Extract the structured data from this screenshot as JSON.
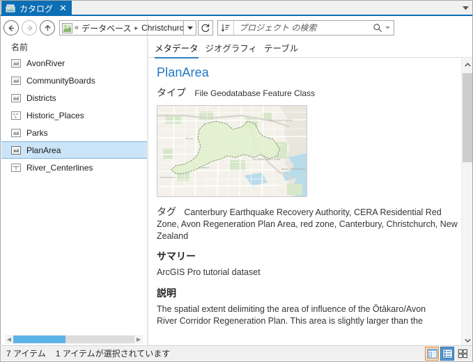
{
  "window": {
    "tab": {
      "icon": "catalog-icon",
      "label": "カタログ",
      "close": "✕"
    },
    "tabstrip_menu_icon": "chevron-down-icon"
  },
  "toolbar": {
    "back_icon": "arrow-left-icon",
    "forward_icon": "arrow-right-icon",
    "up_icon": "arrow-up-icon",
    "breadcrumb": {
      "project_icon": "project-icon",
      "overflow": "«",
      "segments": [
        "データベース",
        "ChristchurchData.gdb"
      ],
      "separator": "▸",
      "dropdown_icon": "chevron-down-icon"
    },
    "refresh_icon": "refresh-icon",
    "search": {
      "sort_icon": "sort-ascending-icon",
      "placeholder": "プロジェクト の検索",
      "value": "",
      "search_icon": "magnifier-icon",
      "caret_icon": "chevron-down-icon"
    }
  },
  "left_panel": {
    "column_header": "名前",
    "items": [
      {
        "label": "AvonRiver",
        "icon": "polygon-feature-class-icon",
        "selected": false
      },
      {
        "label": "CommunityBoards",
        "icon": "polygon-feature-class-icon",
        "selected": false
      },
      {
        "label": "Districts",
        "icon": "polygon-feature-class-icon",
        "selected": false
      },
      {
        "label": "Historic_Places",
        "icon": "point-feature-class-icon",
        "selected": false
      },
      {
        "label": "Parks",
        "icon": "polygon-feature-class-icon",
        "selected": false
      },
      {
        "label": "PlanArea",
        "icon": "polygon-feature-class-icon",
        "selected": true
      },
      {
        "label": "River_Centerlines",
        "icon": "line-feature-class-icon",
        "selected": false
      }
    ],
    "hscroll": {
      "left_arrow_icon": "triangle-left-icon",
      "right_arrow_icon": "triangle-right-icon",
      "thumb_percent": 43
    }
  },
  "right_panel": {
    "tabs": [
      {
        "label": "メタデータ",
        "active": true
      },
      {
        "label": "ジオグラフィ",
        "active": false
      },
      {
        "label": "テーブル",
        "active": false
      }
    ],
    "title": "PlanArea",
    "type_label": "タイプ",
    "type_value": "File Geodatabase Feature Class",
    "thumbnail_alt": "christchurch-plan-area-map-thumbnail",
    "tags_label": "タグ",
    "tags_value": "Canterbury Earthquake Recovery Authority, CERA Residential Red Zone, Avon Regeneration Plan Area, red zone, Canterbury, Christchurch, New Zealand",
    "summary_heading": "サマリー",
    "summary_text": "ArcGIS Pro tutorial dataset",
    "description_heading": "説明",
    "description_text": "The spatial extent delimiting the area of influence of the Ōtākaro/Avon River Corridor Regeneration Plan. This area is slightly larger than the",
    "scrollbar": {
      "up_icon": "chevron-up-icon",
      "down_icon": "chevron-down-icon"
    }
  },
  "status_bar": {
    "item_count": "7 アイテム",
    "selection": "1 アイテムが選択されています",
    "view_buttons": [
      {
        "name": "details-view",
        "icon": "details-panel-icon",
        "state": "hover"
      },
      {
        "name": "list-view",
        "icon": "list-view-icon",
        "state": "active"
      },
      {
        "name": "tile-view",
        "icon": "tile-view-icon",
        "state": "normal"
      }
    ]
  },
  "colors": {
    "accent": "#0c6eb4",
    "selection": "#cce4f7",
    "title_link": "#1c76c4",
    "hover_orange": "#e08a3c",
    "scroll_blue": "#5cb3e8"
  }
}
